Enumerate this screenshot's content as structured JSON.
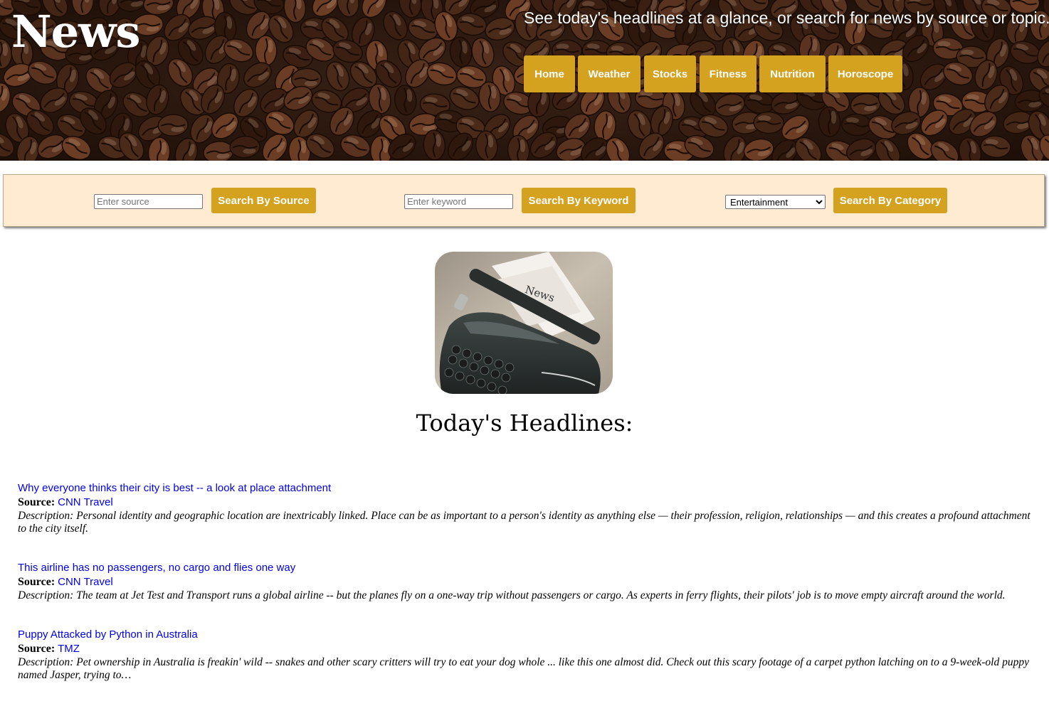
{
  "header": {
    "site_title": "News",
    "tagline": "See today's headlines at a glance, or search for news by source or topic.",
    "nav": [
      {
        "label": "Home"
      },
      {
        "label": "Weather"
      },
      {
        "label": "Stocks"
      },
      {
        "label": "Fitness"
      },
      {
        "label": "Nutrition"
      },
      {
        "label": "Horoscope"
      }
    ]
  },
  "search": {
    "source_placeholder": "Enter source",
    "source_button": "Search By Source",
    "keyword_placeholder": "Enter keyword",
    "keyword_button": "Search By Keyword",
    "category_selected": "Entertainment",
    "category_button": "Search By Category"
  },
  "main": {
    "image_text": "News",
    "headlines_title": "Today's Headlines:",
    "source_label": "Source:",
    "description_label": "Description:",
    "articles": [
      {
        "title": "Why everyone thinks their city is best -- a look at place attachment",
        "source": "CNN Travel",
        "description": "Personal identity and geographic location are inextricably linked. Place can be as important to a person's identity as anything else — their profession, religion, relationships — and this creates a profound attachment to the city itself."
      },
      {
        "title": "This airline has no passengers, no cargo and flies one way",
        "source": "CNN Travel",
        "description": "The team at Jet Test and Transport runs a global airline -- but the planes fly on a one-way trip without passengers or cargo. As experts in ferry flights, their pilots' job is to move empty aircraft around the world."
      },
      {
        "title": "Puppy Attacked by Python in Australia",
        "source": "TMZ",
        "description": "Pet ownership in Australia is freakin' wild -- snakes and other scary critters will try to eat your dog whole ... like this one almost did. Check out this scary footage of a carpet python latching on to a 9-week-old puppy named Jasper, trying to…"
      }
    ]
  },
  "colors": {
    "accent": "#d5a21f",
    "search_bar_bg": "#feebd1",
    "link": "#0000ee"
  }
}
